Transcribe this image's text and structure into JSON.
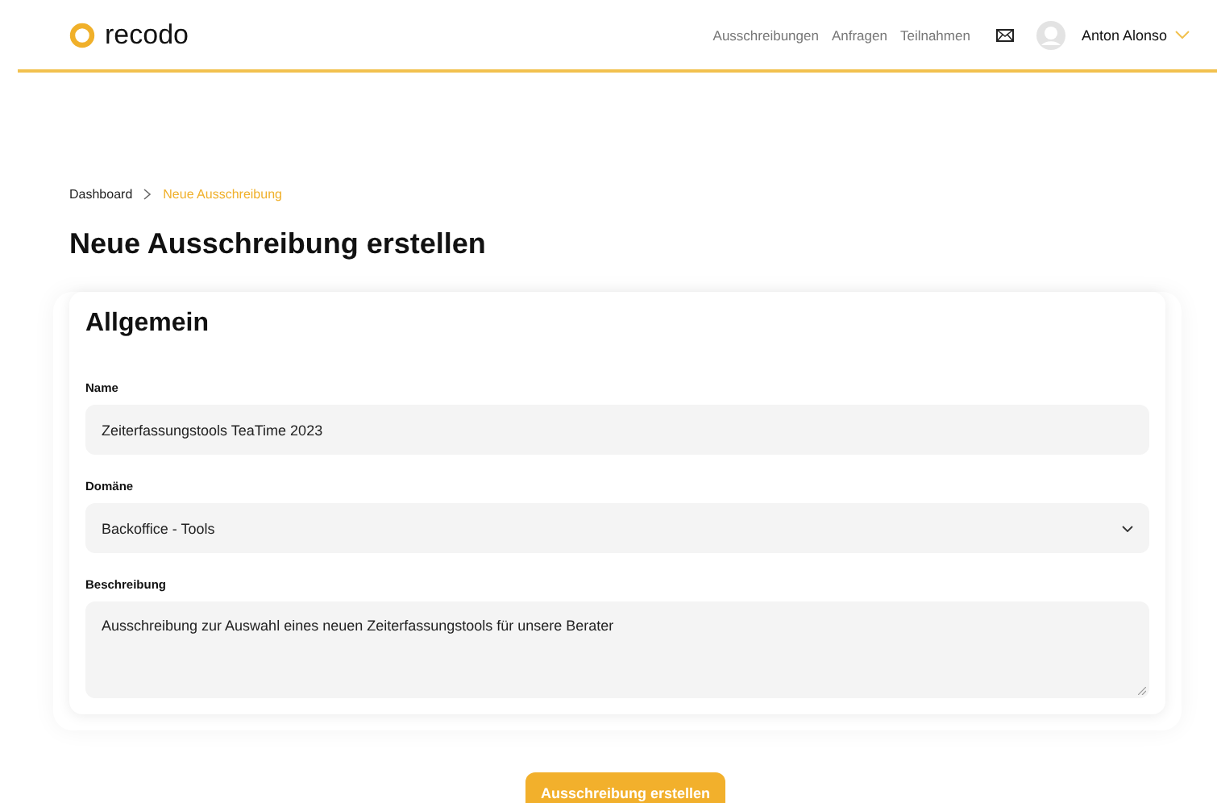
{
  "header": {
    "logo": "recodo",
    "nav": [
      {
        "label": "Ausschreibungen"
      },
      {
        "label": "Anfragen"
      },
      {
        "label": "Teilnahmen"
      }
    ],
    "user": "Anton Alonso"
  },
  "breadcrumb": [
    {
      "label": "Dashboard",
      "selected": false
    },
    {
      "label": "Neue Ausschreibung",
      "selected": true
    }
  ],
  "page_title": "Neue Ausschreibung erstellen",
  "card": {
    "title": "Allgemein",
    "fields": [
      {
        "kind": "text",
        "label": "Name",
        "value": "Zeiterfassungstools TeaTime 2023"
      },
      {
        "kind": "select",
        "label": "Domäne",
        "value": "Backoffice - Tools"
      },
      {
        "kind": "textarea",
        "label": "Beschreibung",
        "value": "Ausschreibung zur Auswahl eines neuen Zeiterfassungstools für unsere Berater"
      }
    ]
  },
  "submit_button": "Ausschreibung erstellen"
}
